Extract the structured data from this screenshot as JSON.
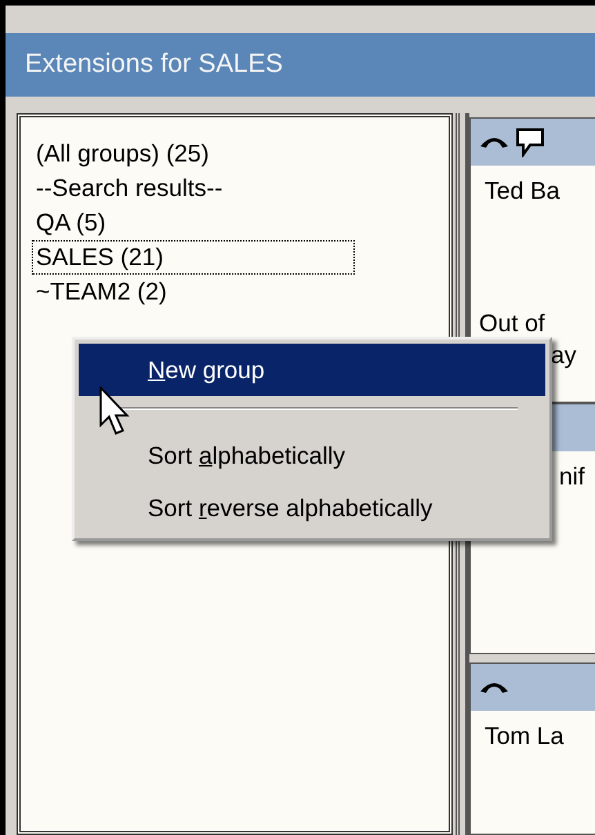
{
  "window": {
    "title": "Extensions for SALES"
  },
  "groups": [
    {
      "label": "(All groups) (25)",
      "selected": false
    },
    {
      "label": "--Search results--",
      "selected": false
    },
    {
      "label": "QA (5)",
      "selected": false
    },
    {
      "label": "SALES (21)",
      "selected": true
    },
    {
      "label": "~TEAM2 (2)",
      "selected": false
    }
  ],
  "cards": [
    {
      "name": "Ted Ba",
      "status": "Out of",
      "status_2": "ay",
      "icons": [
        {
          "kind": "phone"
        },
        {
          "kind": "chat"
        }
      ]
    },
    {
      "name": "nif"
    },
    {
      "name": "Tom La",
      "icons": [
        {
          "kind": "phone"
        }
      ]
    }
  ],
  "context_menu": {
    "items": [
      {
        "kind": "item",
        "key": "N",
        "rest": "ew group",
        "selected": true
      },
      {
        "kind": "separator"
      },
      {
        "kind": "item",
        "prefix": "Sort ",
        "key": "a",
        "rest": "lphabetically",
        "selected": false
      },
      {
        "kind": "item",
        "prefix": "Sort ",
        "key": "r",
        "rest": "everse alphabetically",
        "selected": false
      }
    ]
  }
}
